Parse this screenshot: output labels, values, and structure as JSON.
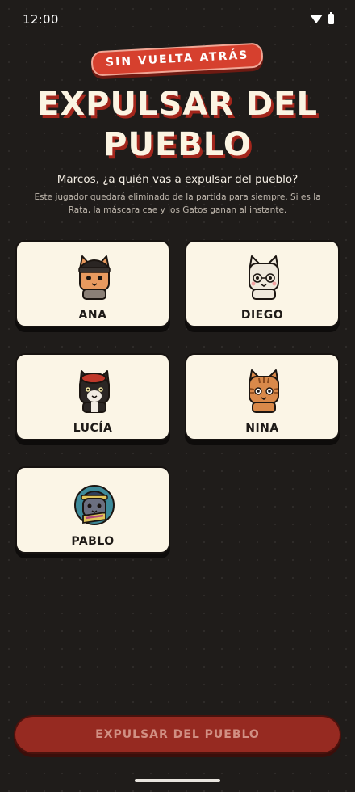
{
  "status": {
    "time": "12:00"
  },
  "header": {
    "tag": "SIN VUELTA ATRÁS",
    "title_line1": "EXPULSAR DEL",
    "title_line2": "PUEBLO",
    "question": "Marcos, ¿a quién vas a expulsar del pueblo?",
    "note": "Este jugador quedará eliminado de la partida para siempre. Si es la Rata, la máscara cae y los Gatos ganan al instante."
  },
  "players": [
    {
      "name": "ANA",
      "avatar": "cat-with-black-beanie-icon"
    },
    {
      "name": "DIEGO",
      "avatar": "white-cat-with-glasses-icon"
    },
    {
      "name": "LUCÍA",
      "avatar": "black-cat-with-red-beret-icon"
    },
    {
      "name": "NINA",
      "avatar": "tabby-cat-icon"
    },
    {
      "name": "PABLO",
      "avatar": "cat-with-hat-and-scarf-icon"
    }
  ],
  "cta": {
    "label": "EXPULSAR DEL PUEBLO"
  },
  "colors": {
    "accent": "#d6402e",
    "card": "#fbf5e6",
    "background": "#1f1c1a",
    "cta_disabled": "#962a21"
  }
}
